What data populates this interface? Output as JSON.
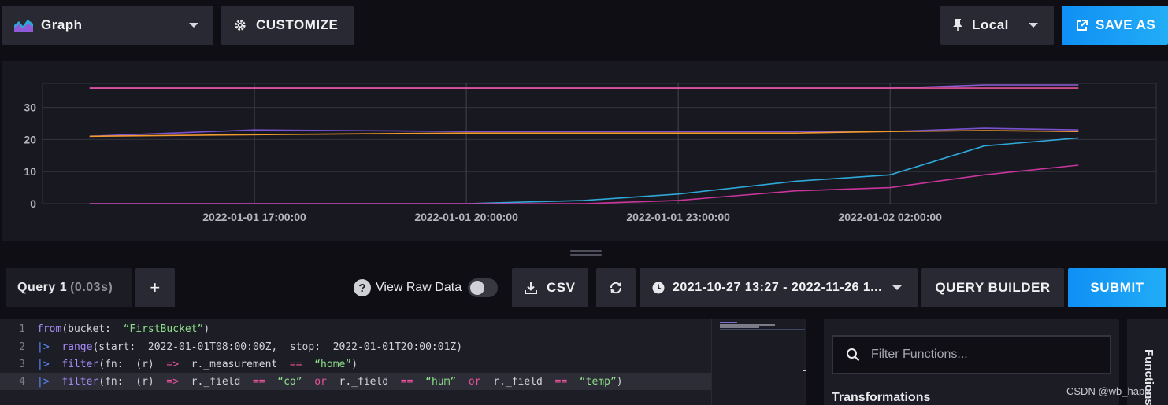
{
  "toolbar": {
    "graph_label": "Graph",
    "customize_label": "CUSTOMIZE",
    "local_label": "Local",
    "save_as_label": "SAVE AS"
  },
  "chart_data": {
    "type": "line",
    "y_ticks": [
      "0",
      "10",
      "20",
      "30"
    ],
    "x_ticks": [
      "2022-01-01 17:00:00",
      "2022-01-01 20:00:00",
      "2022-01-01 23:00:00",
      "2022-01-02 02:00:00"
    ],
    "ylim": [
      0,
      37.5
    ],
    "x": [
      "14:40",
      "17:00",
      "20:00",
      "21:40",
      "23:00",
      "24:40",
      "26:00",
      "27:20",
      "28:40"
    ],
    "series": [
      {
        "color": "#8f5cd9",
        "values": [
          36,
          36,
          36,
          36,
          36,
          36,
          36,
          37,
          37
        ]
      },
      {
        "color": "#e8539b",
        "values": [
          36,
          36,
          36,
          36,
          36,
          36,
          36,
          36,
          36
        ]
      },
      {
        "color": "#7a52d1",
        "values": [
          21,
          23,
          22.5,
          22.5,
          22.5,
          22.5,
          22.5,
          23.5,
          23
        ]
      },
      {
        "color": "#f29a2e",
        "values": [
          21,
          21.5,
          22,
          22,
          22,
          22,
          22.5,
          22.8,
          22.5
        ]
      },
      {
        "color": "#2fa8d8",
        "values": [
          0,
          0,
          0,
          1,
          3,
          7,
          9,
          18,
          20.5
        ]
      },
      {
        "color": "#c8359b",
        "values": [
          0,
          0,
          0,
          0,
          1,
          4,
          5,
          9,
          12
        ]
      }
    ]
  },
  "query": {
    "tab_label": "Query 1",
    "tab_time": "(0.03s)",
    "add_label": "+",
    "raw_data_label": "View Raw Data",
    "raw_help": "?",
    "csv_label": "CSV",
    "time_range_label": "2021-10-27 13:27 - 2022-11-26 1...",
    "query_builder_label": "QUERY BUILDER",
    "submit_label": "SUBMIT"
  },
  "editor": {
    "line_numbers": [
      "1",
      "2",
      "3",
      "4"
    ],
    "lines": [
      [
        [
          "fn",
          "from"
        ],
        [
          "txt",
          "(bucket:  "
        ],
        [
          "str",
          "“FirstBucket”"
        ],
        [
          "txt",
          ")"
        ]
      ],
      [
        [
          "pipe",
          "|>"
        ],
        [
          "txt",
          "  "
        ],
        [
          "fn",
          "range"
        ],
        [
          "txt",
          "(start:  2022-01-01T08:00:00Z,  stop:  2022-01-01T20:00:01Z)"
        ]
      ],
      [
        [
          "pipe",
          "|>"
        ],
        [
          "txt",
          "  "
        ],
        [
          "fn",
          "filter"
        ],
        [
          "txt",
          "(fn:  (r)  "
        ],
        [
          "op",
          "=>"
        ],
        [
          "txt",
          "  r._measurement  "
        ],
        [
          "op",
          "=="
        ],
        [
          "txt",
          "  "
        ],
        [
          "str",
          "“home”"
        ],
        [
          "txt",
          ")"
        ]
      ],
      [
        [
          "pipe",
          "|>"
        ],
        [
          "txt",
          "  "
        ],
        [
          "fn",
          "filter"
        ],
        [
          "txt",
          "(fn:  (r)  "
        ],
        [
          "op",
          "=>"
        ],
        [
          "txt",
          "  r._field  "
        ],
        [
          "op",
          "=="
        ],
        [
          "txt",
          "  "
        ],
        [
          "str",
          "“co”"
        ],
        [
          "txt",
          "  "
        ],
        [
          "op",
          "or"
        ],
        [
          "txt",
          "  r._field  "
        ],
        [
          "op",
          "=="
        ],
        [
          "txt",
          "  "
        ],
        [
          "str",
          "“hum”"
        ],
        [
          "txt",
          "  "
        ],
        [
          "op",
          "or"
        ],
        [
          "txt",
          "  r._field  "
        ],
        [
          "op",
          "=="
        ],
        [
          "txt",
          "  "
        ],
        [
          "str",
          "“temp”"
        ],
        [
          "txt",
          ")"
        ]
      ]
    ]
  },
  "functions": {
    "search_placeholder": "Filter Functions...",
    "section_label": "Transformations",
    "side_label": "Functions"
  },
  "watermark": "CSDN @wb_happ"
}
